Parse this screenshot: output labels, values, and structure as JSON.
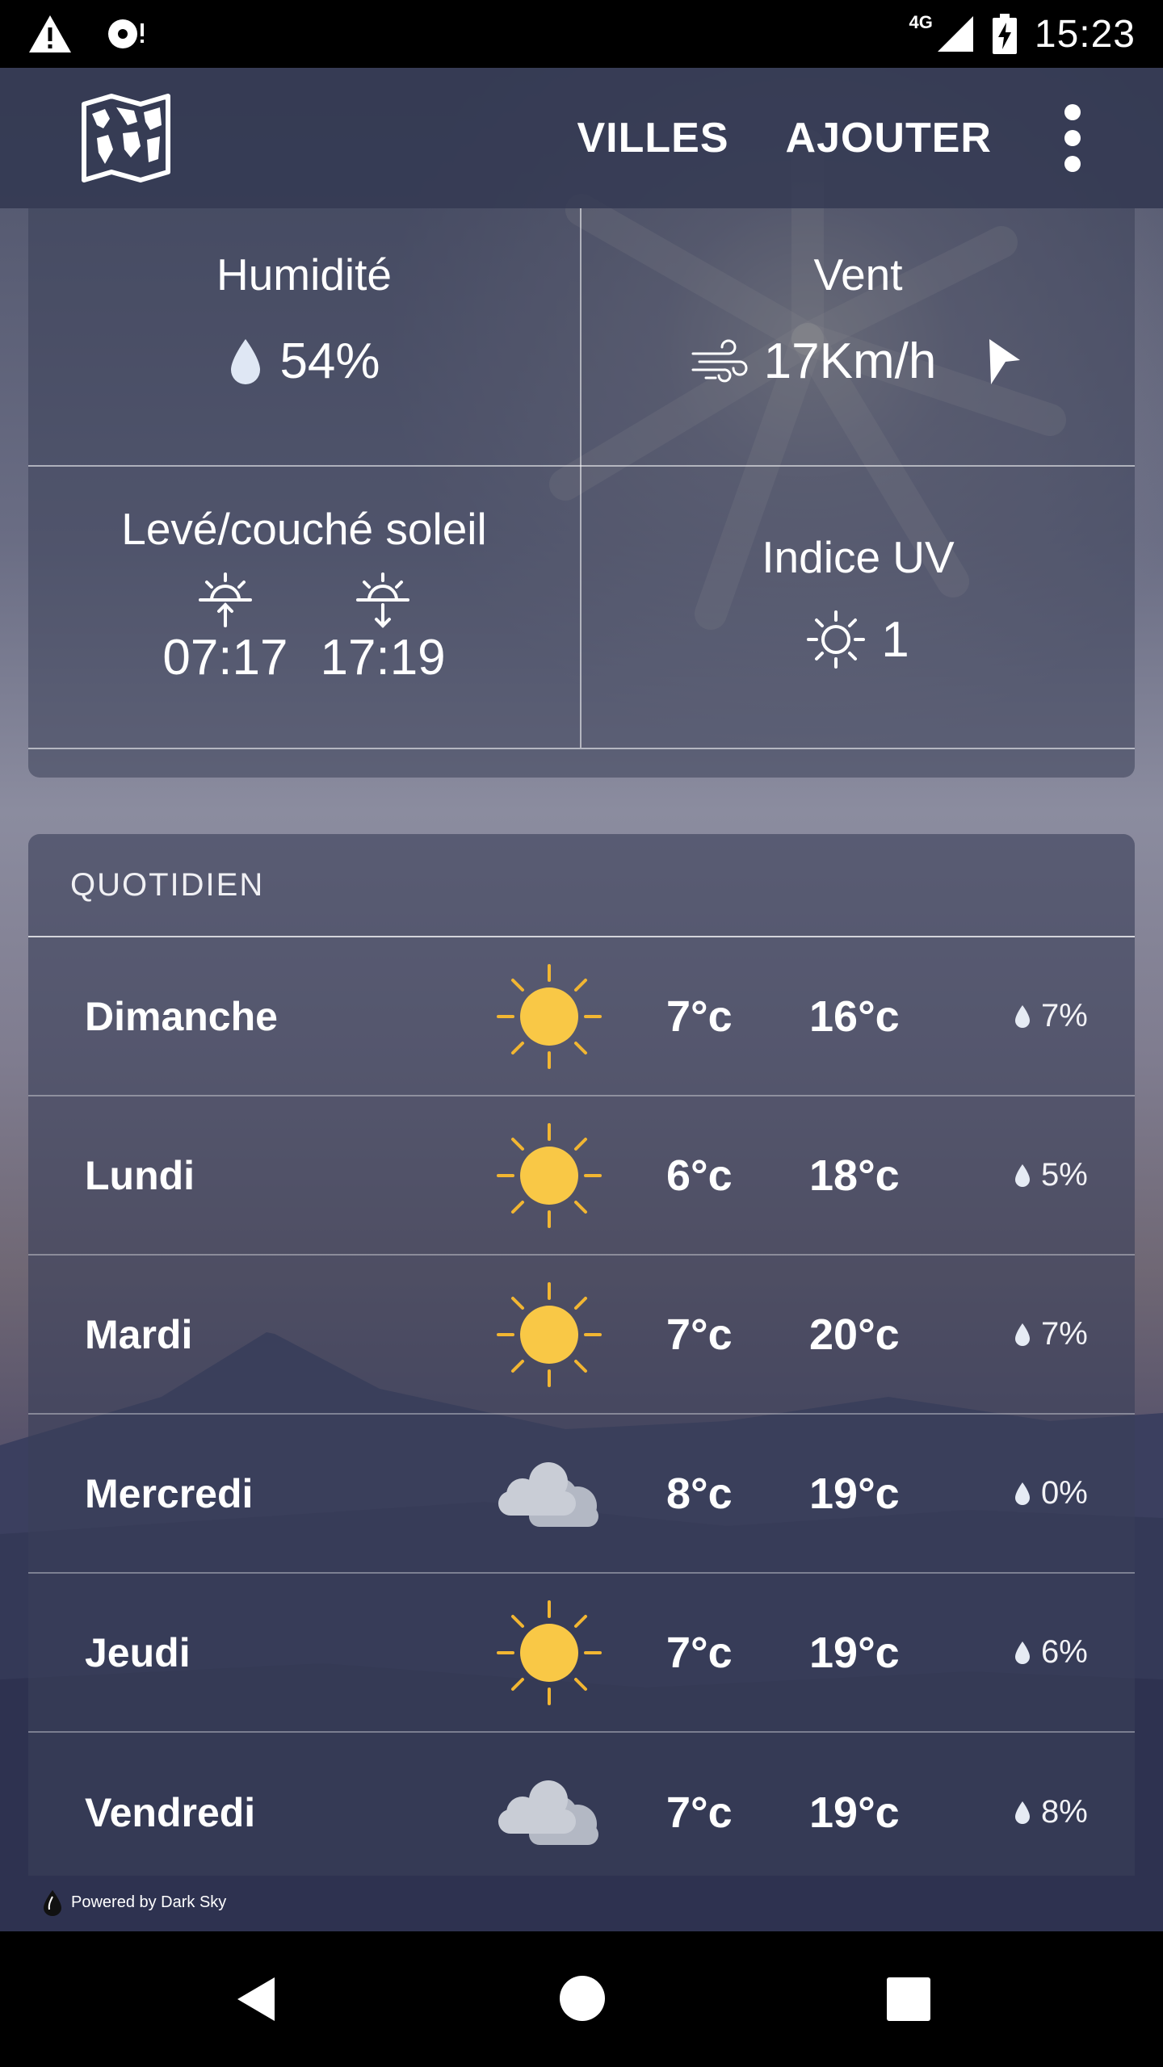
{
  "status_bar": {
    "time": "15:23",
    "network": "4G",
    "icons": [
      "warning-icon",
      "record-icon",
      "signal-icon",
      "battery-charging-icon"
    ]
  },
  "app_bar": {
    "logo_icon": "world-map-icon",
    "actions": [
      {
        "label": "VILLES"
      },
      {
        "label": "AJOUTER"
      }
    ],
    "menu_icon": "overflow-menu-icon"
  },
  "details": {
    "humidity": {
      "title": "Humidité",
      "value": "54%",
      "icon": "water-drop-icon"
    },
    "wind": {
      "title": "Vent",
      "value": "17Km/h",
      "icon": "wind-icon",
      "direction_icon": "wind-direction-icon"
    },
    "sun": {
      "title": "Levé/couché soleil",
      "sunrise": "07:17",
      "sunset": "17:19"
    },
    "uv": {
      "title": "Indice UV",
      "value": "1",
      "icon": "sun-outline-icon"
    }
  },
  "daily": {
    "header": "QUOTIDIEN",
    "days": [
      {
        "name": "Dimanche",
        "icon": "sun",
        "min": "7°c",
        "max": "16°c",
        "precip": "7%"
      },
      {
        "name": "Lundi",
        "icon": "sun",
        "min": "6°c",
        "max": "18°c",
        "precip": "5%"
      },
      {
        "name": "Mardi",
        "icon": "sun",
        "min": "7°c",
        "max": "20°c",
        "precip": "7%"
      },
      {
        "name": "Mercredi",
        "icon": "cloud",
        "min": "8°c",
        "max": "19°c",
        "precip": "0%"
      },
      {
        "name": "Jeudi",
        "icon": "sun",
        "min": "7°c",
        "max": "19°c",
        "precip": "6%"
      },
      {
        "name": "Vendredi",
        "icon": "cloud",
        "min": "7°c",
        "max": "19°c",
        "precip": "8%"
      }
    ]
  },
  "footer": {
    "powered_by": "Powered by Dark Sky"
  },
  "colors": {
    "sun": "#F9C846",
    "sun_ray": "#F2B632",
    "cloud_front": "#C9CDD6",
    "cloud_back": "#B3B8C4",
    "card": "#3A3F58"
  }
}
